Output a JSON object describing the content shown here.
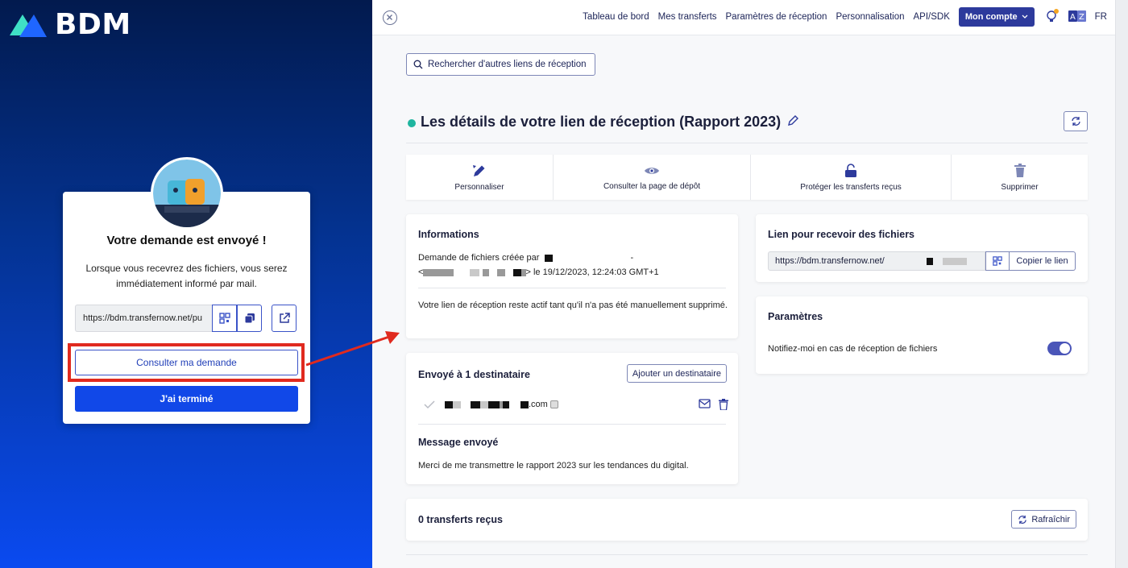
{
  "brand": {
    "name": "BDM"
  },
  "card": {
    "title": "Votre demande est envoyé !",
    "description": "Lorsque vous recevrez des fichiers, vous serez immédiatement informé par mail.",
    "link_value": "https://bdm.transfernow.net/pu",
    "consult_label": "Consulter ma demande",
    "done_label": "J'ai terminé"
  },
  "nav": {
    "items": [
      "Tableau de bord",
      "Mes transferts",
      "Paramètres de réception",
      "Personnalisation",
      "API/SDK"
    ],
    "account_label": "Mon compte",
    "language": "FR"
  },
  "main": {
    "search_label": "Rechercher d'autres liens de réception",
    "title": "Les détails de votre lien de réception (Rapport 2023)",
    "actions": [
      {
        "label": "Personnaliser",
        "icon": "pencil-icon"
      },
      {
        "label": "Consulter la page de dépôt",
        "icon": "eye-icon"
      },
      {
        "label": "Protéger les transferts reçus",
        "icon": "lock-icon"
      },
      {
        "label": "Supprimer",
        "icon": "trash-icon"
      }
    ],
    "info": {
      "title": "Informations",
      "created_prefix": "Demande de fichiers créée par",
      "created_suffix": "> le 19/12/2023, 12:24:03 GMT+1",
      "active_note": "Votre lien de réception reste actif tant qu'il n'a pas été manuellement supprimé."
    },
    "recipients": {
      "title": "Envoyé à 1 destinataire",
      "add_label": "Ajouter un destinataire",
      "email_suffix": ".com",
      "message_title": "Message envoyé",
      "message_text": "Merci de me transmettre le rapport 2023 sur les tendances du digital."
    },
    "link_panel": {
      "title": "Lien pour recevoir des fichiers",
      "value": "https://bdm.transfernow.net/",
      "copy_label": "Copier le lien"
    },
    "settings": {
      "title": "Paramètres",
      "notify_label": "Notifiez-moi en cas de réception de fichiers"
    },
    "transfers": {
      "title": "0 transferts reçus",
      "refresh_label": "Rafraîchir"
    }
  },
  "colors": {
    "primary": "#1148e8",
    "accent_dark": "#2d3a9c",
    "highlight": "#e02a1f",
    "status_active": "#1fb59f"
  }
}
